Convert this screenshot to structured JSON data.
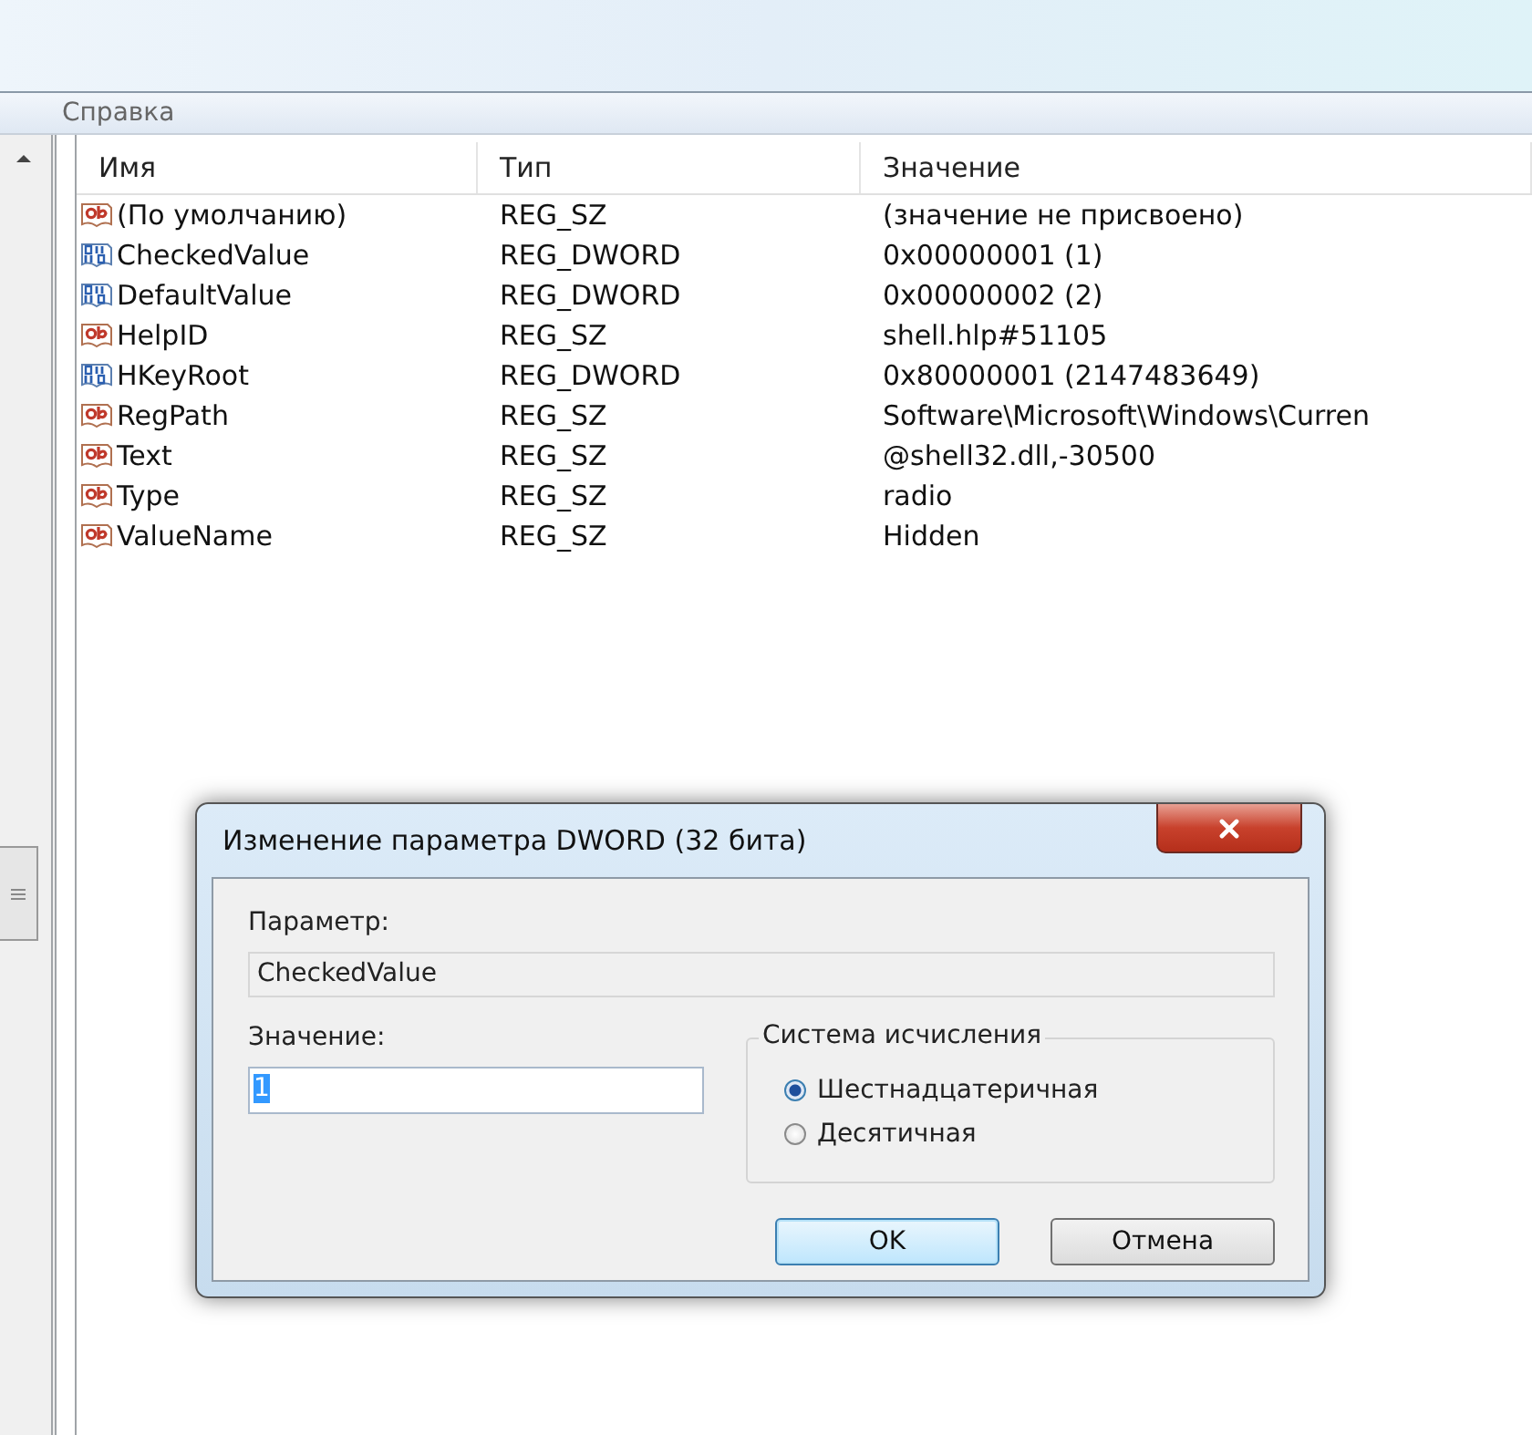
{
  "menu": [
    {
      "label": "Справка"
    }
  ],
  "table": {
    "columns": [
      "Имя",
      "Тип",
      "Значение"
    ],
    "rows": [
      {
        "kind": "string",
        "name": "(По умолчанию)",
        "type": "REG_SZ",
        "data": "(значение не присвоено)"
      },
      {
        "kind": "dword",
        "name": "CheckedValue",
        "type": "REG_DWORD",
        "data": "0x00000001 (1)"
      },
      {
        "kind": "dword",
        "name": "DefaultValue",
        "type": "REG_DWORD",
        "data": "0x00000002 (2)"
      },
      {
        "kind": "string",
        "name": "HelpID",
        "type": "REG_SZ",
        "data": "shell.hlp#51105"
      },
      {
        "kind": "dword",
        "name": "HKeyRoot",
        "type": "REG_DWORD",
        "data": "0x80000001 (2147483649)"
      },
      {
        "kind": "string",
        "name": "RegPath",
        "type": "REG_SZ",
        "data": "Software\\Microsoft\\Windows\\Curren"
      },
      {
        "kind": "string",
        "name": "Text",
        "type": "REG_SZ",
        "data": "@shell32.dll,-30500"
      },
      {
        "kind": "string",
        "name": "Type",
        "type": "REG_SZ",
        "data": "radio"
      },
      {
        "kind": "string",
        "name": "ValueName",
        "type": "REG_SZ",
        "data": "Hidden"
      }
    ]
  },
  "dialog": {
    "title": "Изменение параметра DWORD (32 бита)",
    "name_label": "Параметр:",
    "name_value": "CheckedValue",
    "value_label": "Значение:",
    "value": "1",
    "value_selected": true,
    "base_group": {
      "title": "Система исчисления",
      "options": [
        {
          "label": "Шестнадцатеричная",
          "selected": true
        },
        {
          "label": "Десятичная",
          "selected": false
        }
      ]
    },
    "buttons": [
      {
        "label": "OK",
        "default": true
      },
      {
        "label": "Отмена",
        "default": false
      }
    ]
  }
}
